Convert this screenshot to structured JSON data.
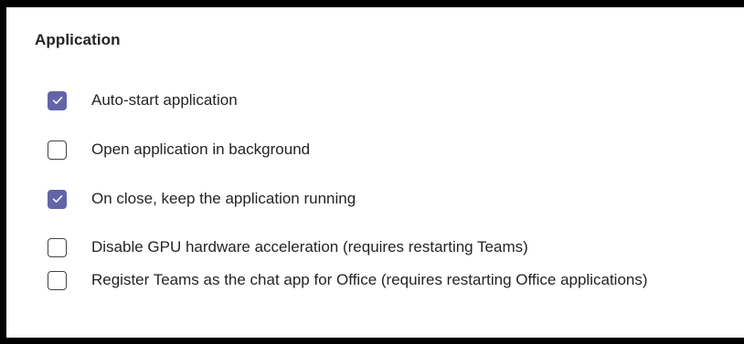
{
  "section": {
    "title": "Application"
  },
  "options": [
    {
      "label": "Auto-start application",
      "checked": true
    },
    {
      "label": "Open application in background",
      "checked": false
    },
    {
      "label": "On close, keep the application running",
      "checked": true
    },
    {
      "label": "Disable GPU hardware acceleration (requires restarting Teams)",
      "checked": false
    },
    {
      "label": "Register Teams as the chat app for Office (requires restarting Office applications)",
      "checked": false
    }
  ],
  "colors": {
    "accent": "#6264a7",
    "text": "#242424",
    "border": "#424242"
  },
  "icons": {
    "checked": "checkmark-icon"
  }
}
